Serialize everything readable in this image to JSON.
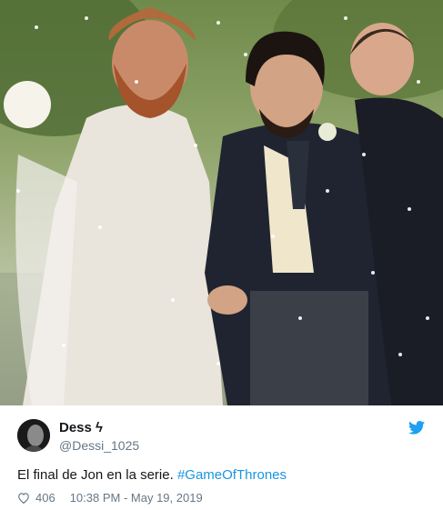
{
  "tweet": {
    "display_name": "Dess",
    "verified_glyph": "ϟ",
    "handle": "@Dessi_1025",
    "text": "El final de Jon en la serie.",
    "hashtag": "#GameOfThrones",
    "likes": "406",
    "timestamp": "10:38 PM - May 19, 2019"
  },
  "icons": {
    "brand": "twitter-bird-icon",
    "like": "heart-icon"
  },
  "colors": {
    "accent": "#1da1f2",
    "link": "#1b95e0",
    "muted": "#657786",
    "text": "#14171a"
  }
}
